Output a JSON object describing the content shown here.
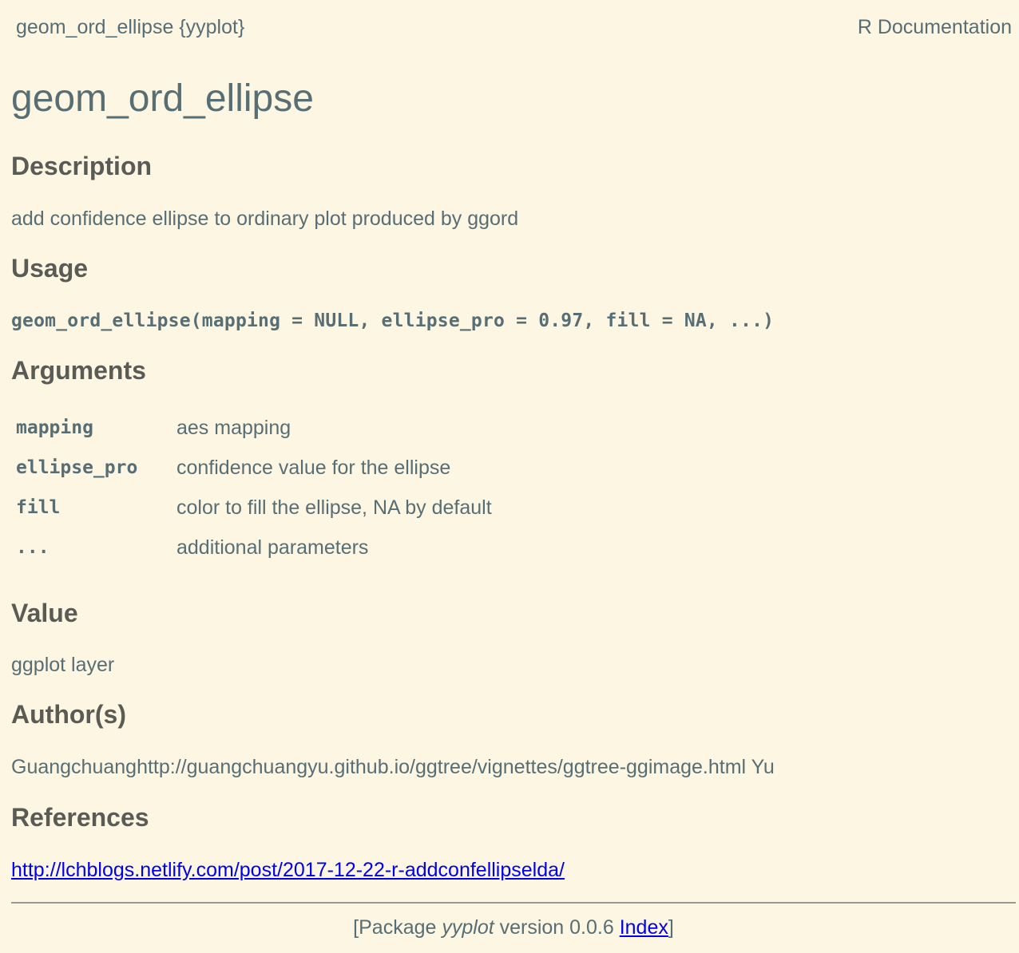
{
  "header": {
    "topic": "geom_ord_ellipse {yyplot}",
    "doc_label": "R Documentation"
  },
  "title": "geom_ord_ellipse",
  "sections": {
    "description": {
      "heading": "Description",
      "text": "add confidence ellipse to ordinary plot produced by ggord"
    },
    "usage": {
      "heading": "Usage",
      "code": "geom_ord_ellipse(mapping = NULL, ellipse_pro = 0.97, fill = NA, ...)"
    },
    "arguments": {
      "heading": "Arguments",
      "items": [
        {
          "name": "mapping",
          "desc": "aes mapping"
        },
        {
          "name": "ellipse_pro",
          "desc": "confidence value for the ellipse"
        },
        {
          "name": "fill",
          "desc": "color to fill the ellipse, NA by default"
        },
        {
          "name": "...",
          "desc": "additional parameters"
        }
      ]
    },
    "value": {
      "heading": "Value",
      "text": "ggplot layer"
    },
    "authors": {
      "heading": "Author(s)",
      "text": "Guangchuanghttp://guangchuangyu.github.io/ggtree/vignettes/ggtree-ggimage.html Yu"
    },
    "references": {
      "heading": "References",
      "link": "http://lchblogs.netlify.com/post/2017-12-22-r-addconfellipselda/"
    }
  },
  "footer": {
    "prefix": "[Package ",
    "package": "yyplot",
    "version_text": " version 0.0.6 ",
    "index_label": "Index",
    "suffix": "]"
  },
  "colors": {
    "background": "#fdf6e3",
    "text": "#586e75",
    "link": "#0000ee"
  }
}
